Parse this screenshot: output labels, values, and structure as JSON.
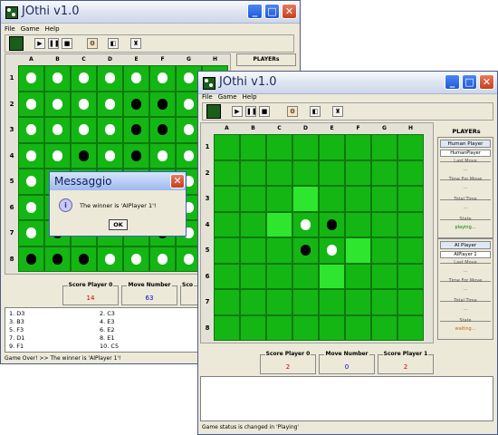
{
  "back_window": {
    "title": "JOthi v1.0",
    "menu": [
      "File",
      "Game",
      "Help"
    ],
    "players_label": "PLAYERs",
    "columns": [
      "A",
      "B",
      "C",
      "D",
      "E",
      "F",
      "G",
      "H"
    ],
    "rows": [
      "1",
      "2",
      "3",
      "4",
      "5",
      "6",
      "7",
      "8"
    ],
    "board": [
      "WWWWWWWW",
      "WWWWBBWW",
      "WWWWBBWW",
      "WWBWBWWW",
      "WW..W.WW",
      "WW..W.WW",
      "WB...BWW",
      "BBBWWWWB"
    ],
    "score_player0_label": "Score Player 0",
    "score_player0_value": "14",
    "move_number_label": "Move Number",
    "move_number_value": "63",
    "score_player1_label_partial": "Sco",
    "moves_col1": [
      "1.  D3",
      "3.  B3",
      "5.  F3",
      "7.  D1",
      "9.  F1"
    ],
    "moves_col2": [
      "2.  C3",
      "4.  E3",
      "6.  E2",
      "8.  E1",
      "10.  C5"
    ],
    "status": "Game Over! >> The winner is 'AIPlayer 1'!"
  },
  "dialog": {
    "title": "Messaggio",
    "message": "The winner is 'AIPlayer 1'!",
    "ok_label": "OK",
    "info_icon_glyph": "i"
  },
  "front_window": {
    "title": "JOthi v1.0",
    "menu": [
      "File",
      "Game",
      "Help"
    ],
    "columns": [
      "A",
      "B",
      "C",
      "D",
      "E",
      "F",
      "G",
      "H"
    ],
    "rows": [
      "1",
      "2",
      "3",
      "4",
      "5",
      "6",
      "7",
      "8"
    ],
    "board": [
      "........",
      "........",
      "...h....",
      "..hWB...",
      "...BWh..",
      "....h...",
      "........",
      "........"
    ],
    "players_label": "PLAYERs",
    "human_panel": {
      "title": "Human Player",
      "name": "HumanPlayer",
      "last_move_label": "Last Move",
      "last_move_value": "...",
      "time_for_move_label": "Time For Move",
      "time_for_move_value": "...",
      "total_time_label": "Total Time",
      "total_time_value": "...",
      "state_label": "State",
      "state_value": "playing..."
    },
    "ai_panel": {
      "title": "AI Player",
      "name": "AIPlayer 1",
      "last_move_label": "Last Move",
      "last_move_value": "...",
      "time_for_move_label": "Time For Move",
      "time_for_move_value": "...",
      "total_time_label": "Total Time",
      "total_time_value": "...",
      "state_label": "State",
      "state_value": "waiting..."
    },
    "score_player0_label": "Score Player 0",
    "score_player0_value": "2",
    "move_number_label": "Move Number",
    "move_number_value": "0",
    "score_player1_label": "Score Player 1",
    "score_player1_value": "2",
    "status": "Game status is changed in 'Playing'"
  },
  "colors": {
    "board_green": "#14b614",
    "highlight_green": "#2ee62e",
    "score_red": "#cc0000",
    "move_blue": "#0000cc",
    "state_playing": "#008000",
    "state_waiting": "#cc6600"
  }
}
